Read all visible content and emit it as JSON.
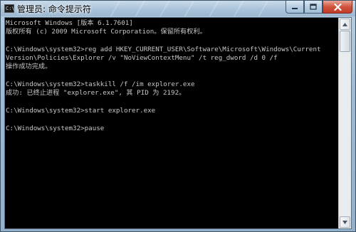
{
  "window": {
    "title": "管理员: 命令提示符",
    "icon_text": "C:\\",
    "controls": [
      "minimize",
      "maximize",
      "close"
    ]
  },
  "console": {
    "lines": [
      "Microsoft Windows [版本 6.1.7601]",
      "版权所有 (c) 2009 Microsoft Corporation。保留所有权利。",
      "",
      "C:\\Windows\\system32>reg add HKEY_CURRENT_USER\\Software\\Microsoft\\Windows\\Current",
      "Version\\Policies\\Explorer /v \"NoViewContextMenu\" /t reg_dword /d 0 /f",
      "操作成功完成。",
      "",
      "C:\\Windows\\system32>taskkill /f /im explorer.exe",
      "成功: 已终止进程 \"explorer.exe\", 其 PID 为 2192。",
      "",
      "C:\\Windows\\system32>start explorer.exe",
      "",
      "C:\\Windows\\system32>pause"
    ]
  },
  "colors": {
    "console_bg": "#000000",
    "console_text": "#c8c8c8",
    "close_button": "#c13b26"
  }
}
